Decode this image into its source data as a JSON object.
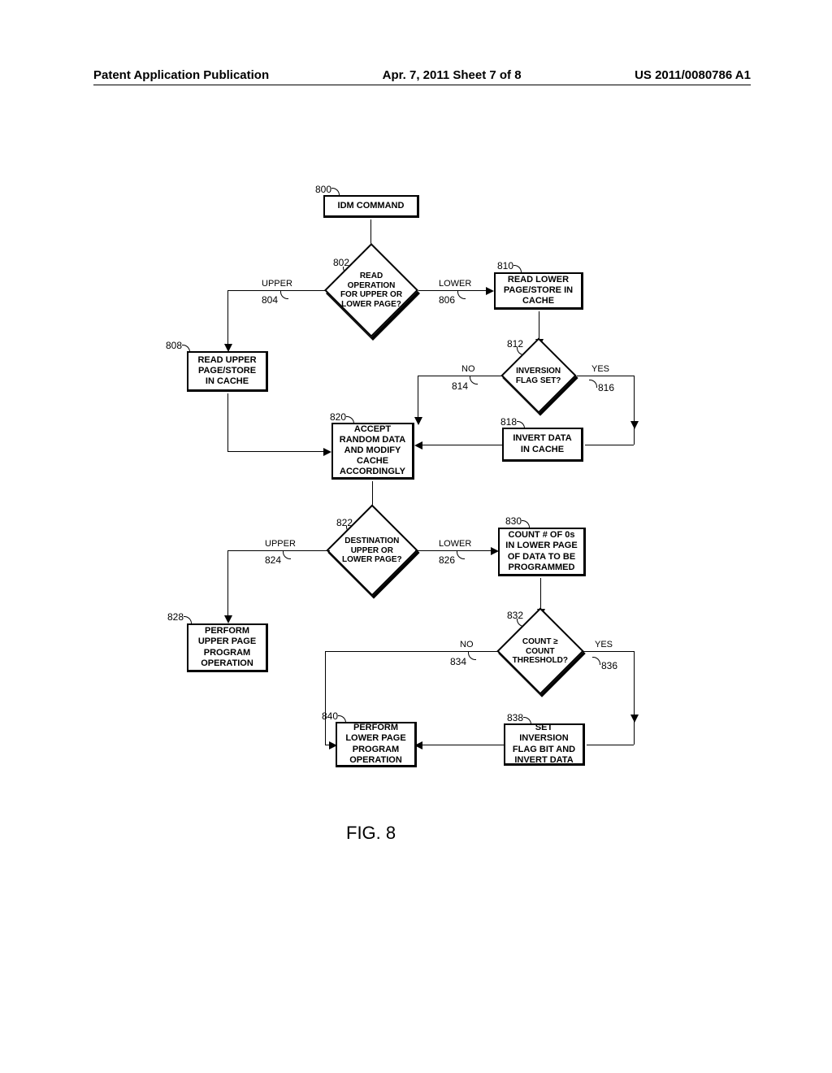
{
  "header": {
    "left": "Patent Application Publication",
    "middle": "Apr. 7, 2011  Sheet 7 of 8",
    "right": "US 2011/0080786 A1"
  },
  "nodes": {
    "n800": {
      "ref": "800",
      "text": "IDM COMMAND"
    },
    "n802": {
      "ref": "802",
      "text": "READ OPERATION FOR UPPER OR LOWER PAGE?"
    },
    "n804": {
      "ref": "804",
      "text": "UPPER"
    },
    "n806": {
      "ref": "806",
      "text": "LOWER"
    },
    "n808": {
      "ref": "808",
      "text": "READ UPPER PAGE/STORE IN CACHE"
    },
    "n810": {
      "ref": "810",
      "text": "READ LOWER PAGE/STORE IN CACHE"
    },
    "n812": {
      "ref": "812",
      "text": "INVERSION FLAG SET?"
    },
    "n814": {
      "ref": "814",
      "text": "NO"
    },
    "n816": {
      "ref": "816",
      "text": "YES"
    },
    "n818": {
      "ref": "818",
      "text": "INVERT DATA IN CACHE"
    },
    "n820": {
      "ref": "820",
      "text": "ACCEPT RANDOM DATA AND MODIFY CACHE ACCORDINGLY"
    },
    "n822": {
      "ref": "822",
      "text": "DESTINATION UPPER OR LOWER PAGE?"
    },
    "n824": {
      "ref": "824",
      "text": "UPPER"
    },
    "n826": {
      "ref": "826",
      "text": "LOWER"
    },
    "n828": {
      "ref": "828",
      "text": "PERFORM UPPER PAGE PROGRAM OPERATION"
    },
    "n830": {
      "ref": "830",
      "text": "COUNT # OF 0s IN LOWER PAGE OF DATA TO BE PROGRAMMED"
    },
    "n832": {
      "ref": "832",
      "text": "COUNT ≥ COUNT THRESHOLD?"
    },
    "n834": {
      "ref": "834",
      "text": "NO"
    },
    "n836": {
      "ref": "836",
      "text": "YES"
    },
    "n838": {
      "ref": "838",
      "text": "SET INVERSION FLAG BIT AND INVERT DATA"
    },
    "n840": {
      "ref": "840",
      "text": "PERFORM LOWER PAGE PROGRAM OPERATION"
    }
  },
  "figure_label": "FIG. 8"
}
